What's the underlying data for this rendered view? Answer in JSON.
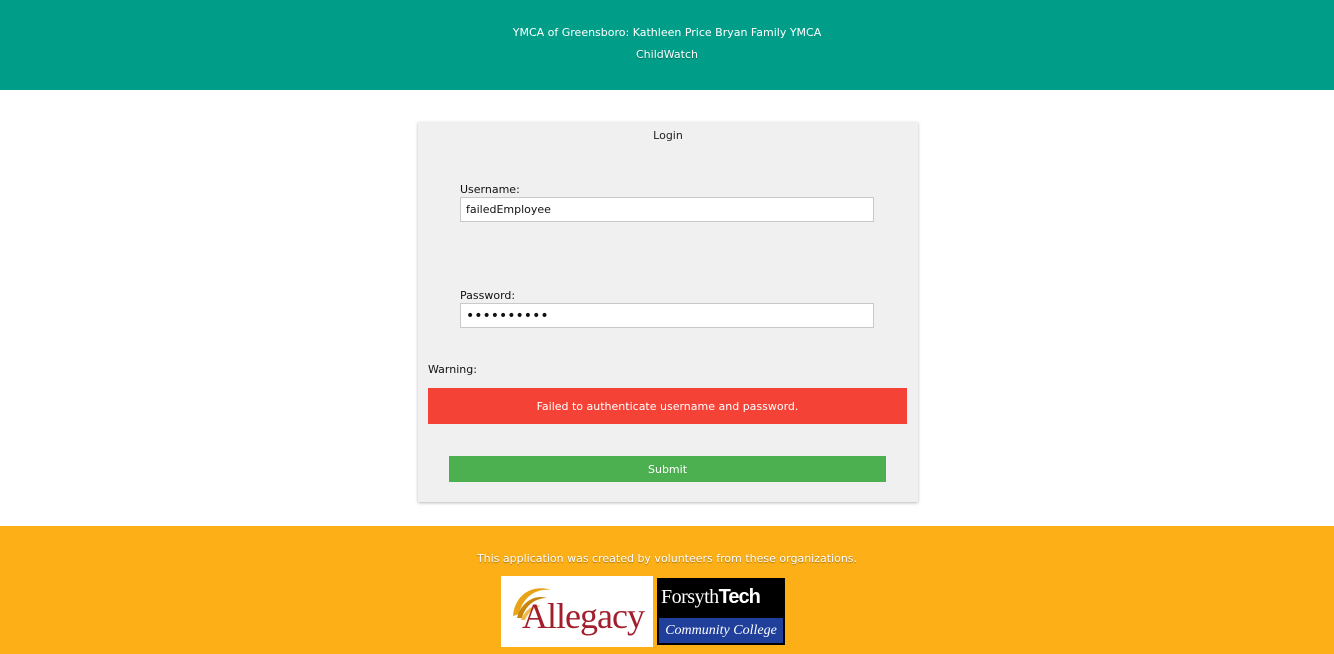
{
  "header": {
    "organization": "YMCA of Greensboro: Kathleen Price Bryan Family YMCA",
    "app_name": "ChildWatch"
  },
  "login": {
    "title": "Login",
    "username_label": "Username:",
    "username_value": "failedEmployee",
    "password_label": "Password:",
    "password_value": "••••••••••",
    "warning_label": "Warning:",
    "warning_message": "Failed to authenticate username and password.",
    "submit_label": "Submit"
  },
  "footer": {
    "text": "This application was created by volunteers from these organizations.",
    "logos": [
      {
        "name": "Allegacy",
        "text": "Allegacy"
      },
      {
        "name": "Forsyth Tech Community College",
        "text_top_a": "Forsyth",
        "text_top_b": "Tech",
        "text_bottom": "Community College"
      }
    ]
  },
  "colors": {
    "header_bg": "#009e88",
    "warning_bg": "#f44336",
    "submit_bg": "#4caf50",
    "footer_bg": "#fcaf17"
  }
}
